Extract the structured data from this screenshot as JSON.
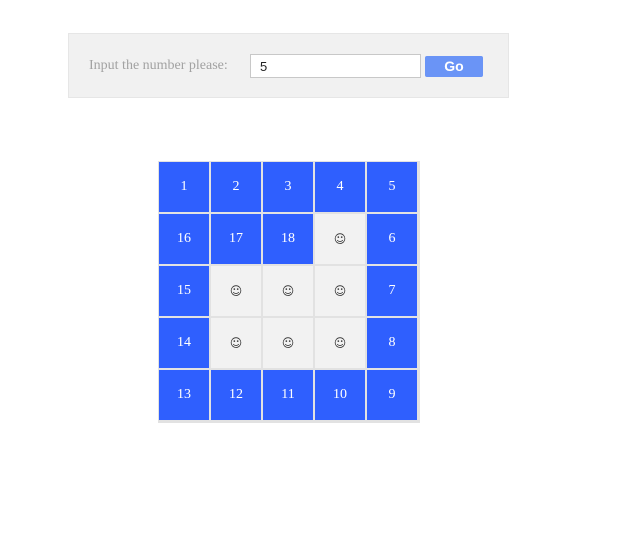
{
  "form": {
    "prompt": "Input the number please:",
    "input_value": "5",
    "go_label": "Go"
  },
  "colors": {
    "filled": "#2f5ffe",
    "empty": "#f2f2f2",
    "button": "#6a94f6"
  },
  "grid": {
    "size": 5,
    "cells": [
      {
        "text": "1",
        "filled": true
      },
      {
        "text": "2",
        "filled": true
      },
      {
        "text": "3",
        "filled": true
      },
      {
        "text": "4",
        "filled": true
      },
      {
        "text": "5",
        "filled": true
      },
      {
        "text": "16",
        "filled": true
      },
      {
        "text": "17",
        "filled": true
      },
      {
        "text": "18",
        "filled": true
      },
      {
        "text": "☺",
        "filled": false
      },
      {
        "text": "6",
        "filled": true
      },
      {
        "text": "15",
        "filled": true
      },
      {
        "text": "☺",
        "filled": false
      },
      {
        "text": "☺",
        "filled": false
      },
      {
        "text": "☺",
        "filled": false
      },
      {
        "text": "7",
        "filled": true
      },
      {
        "text": "14",
        "filled": true
      },
      {
        "text": "☺",
        "filled": false
      },
      {
        "text": "☺",
        "filled": false
      },
      {
        "text": "☺",
        "filled": false
      },
      {
        "text": "8",
        "filled": true
      },
      {
        "text": "13",
        "filled": true
      },
      {
        "text": "12",
        "filled": true
      },
      {
        "text": "11",
        "filled": true
      },
      {
        "text": "10",
        "filled": true
      },
      {
        "text": "9",
        "filled": true
      }
    ]
  }
}
